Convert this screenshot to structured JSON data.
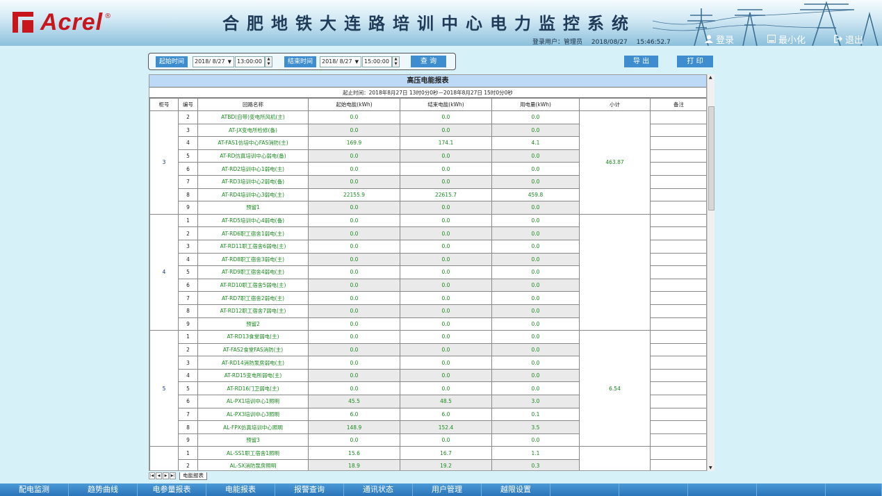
{
  "header": {
    "logo_text": "Acrel",
    "logo_reg": "®",
    "system_title": "合肥地铁大连路培训中心电力监控系统",
    "login_user_label": "登录用户：",
    "login_user": "管理员",
    "date": "2018/08/27",
    "time": "15:46:52.7",
    "login_label": "登录",
    "minimize_label": "最小化",
    "exit_label": "退出"
  },
  "query": {
    "start_label": "起始时间",
    "start_date": "2018/ 8/27",
    "start_time": "13:00:00",
    "end_label": "结束时间",
    "end_date": "2018/ 8/27",
    "end_time": "15:00:00",
    "query_label": "查 询",
    "export_label": "导 出",
    "print_label": "打 印"
  },
  "report": {
    "title": "高压电能报表",
    "range_text": "起止时间：2018年8月27日 13时0分0秒－2018年8月27日 15时0分0秒",
    "columns": [
      "柜号",
      "编号",
      "回路名称",
      "起始电能(kWh)",
      "结束电能(kWh)",
      "用电量(kWh)",
      "小计",
      "备注"
    ],
    "groups": [
      {
        "cabinet": "3",
        "subtotal": "463.87",
        "rows": [
          [
            "2",
            "ATBD(自带)变电所风机(主)",
            "0.0",
            "0.0",
            "0.0"
          ],
          [
            "3",
            "AT-JX变电所检修(备)",
            "0.0",
            "0.0",
            "0.0"
          ],
          [
            "4",
            "AT-FAS1仿培中心FAS消防(主)",
            "169.9",
            "174.1",
            "4.1"
          ],
          [
            "5",
            "AT-RD仿真培训中心弱电(备)",
            "0.0",
            "0.0",
            "0.0"
          ],
          [
            "6",
            "AT-RD2培训中心1弱电(主)",
            "0.0",
            "0.0",
            "0.0"
          ],
          [
            "7",
            "AT-RD3培训中心2弱电(备)",
            "0.0",
            "0.0",
            "0.0"
          ],
          [
            "8",
            "AT-RD4培训中心3弱电(主)",
            "22155.9",
            "22615.7",
            "459.8"
          ],
          [
            "9",
            "预留1",
            "0.0",
            "0.0",
            "0.0"
          ]
        ]
      },
      {
        "cabinet": "4",
        "subtotal": "",
        "rows": [
          [
            "1",
            "AT-RD5培训中心4弱电(备)",
            "0.0",
            "0.0",
            "0.0"
          ],
          [
            "2",
            "AT-RD6职工宿舍1弱电(主)",
            "0.0",
            "0.0",
            "0.0"
          ],
          [
            "3",
            "AT-RD11职工宿舍6弱电(主)",
            "0.0",
            "0.0",
            "0.0"
          ],
          [
            "4",
            "AT-RD8职工宿舍3弱电(主)",
            "0.0",
            "0.0",
            "0.0"
          ],
          [
            "5",
            "AT-RD9职工宿舍4弱电(主)",
            "0.0",
            "0.0",
            "0.0"
          ],
          [
            "6",
            "AT-RD10职工宿舍5弱电(主)",
            "0.0",
            "0.0",
            "0.0"
          ],
          [
            "7",
            "AT-RD7职工宿舍2弱电(主)",
            "0.0",
            "0.0",
            "0.0"
          ],
          [
            "8",
            "AT-RD12职工宿舍7弱电(主)",
            "0.0",
            "0.0",
            "0.0"
          ],
          [
            "9",
            "预留2",
            "0.0",
            "0.0",
            "0.0"
          ]
        ]
      },
      {
        "cabinet": "5",
        "subtotal": "6.54",
        "rows": [
          [
            "1",
            "AT-RD13食堂弱电(主)",
            "0.0",
            "0.0",
            "0.0"
          ],
          [
            "2",
            "AT-FAS2食堂FAS消防(主)",
            "0.0",
            "0.0",
            "0.0"
          ],
          [
            "3",
            "AT-RD14消防泵房弱电(主)",
            "0.0",
            "0.0",
            "0.0"
          ],
          [
            "4",
            "AT-RD15变电所弱电(主)",
            "0.0",
            "0.0",
            "0.0"
          ],
          [
            "5",
            "AT-RD16门卫弱电(主)",
            "0.0",
            "0.0",
            "0.0"
          ],
          [
            "6",
            "AL-PX1培训中心1照明",
            "45.5",
            "48.5",
            "3.0"
          ],
          [
            "7",
            "AL-PX3培训中心3照明",
            "6.0",
            "6.0",
            "0.1"
          ],
          [
            "8",
            "AL-FPX仿真培训中心照明",
            "148.9",
            "152.4",
            "3.5"
          ],
          [
            "9",
            "预留3",
            "0.0",
            "0.0",
            "0.0"
          ]
        ]
      },
      {
        "cabinet": "",
        "subtotal": "",
        "rows": [
          [
            "1",
            "AL-SS1职工宿舍1照明",
            "15.6",
            "16.7",
            "1.1"
          ],
          [
            "2",
            "AL-SX消防泵房照明",
            "18.9",
            "19.2",
            "0.3"
          ]
        ]
      }
    ],
    "sheet_tab": "电能报表"
  },
  "nav": [
    "配电监测",
    "趋势曲线",
    "电参量报表",
    "电能报表",
    "报警查询",
    "通讯状态",
    "用户管理",
    "越限设置"
  ],
  "colors": {
    "accent": "#3e8ecf",
    "value_green": "#198b1e",
    "brand_red": "#c8161d",
    "nav_blue": "#2a74b9"
  }
}
